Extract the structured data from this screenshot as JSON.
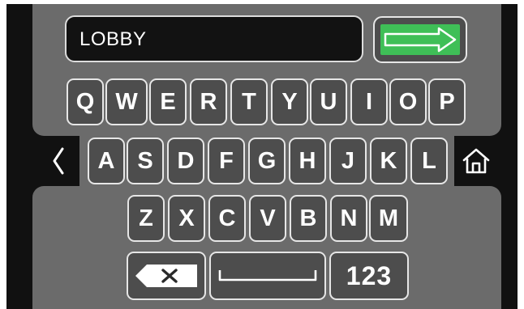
{
  "input": {
    "value": "LOBBY"
  },
  "enter_button": {
    "icon": "arrow-right-icon",
    "color": "#3fbf57"
  },
  "back_button": {
    "icon": "chevron-left-icon"
  },
  "home_button": {
    "icon": "home-icon"
  },
  "keyboard": {
    "row1": [
      "Q",
      "W",
      "E",
      "R",
      "T",
      "Y",
      "U",
      "I",
      "O",
      "P"
    ],
    "row2": [
      "A",
      "S",
      "D",
      "F",
      "G",
      "H",
      "J",
      "K",
      "L"
    ],
    "row3": [
      "Z",
      "X",
      "C",
      "V",
      "B",
      "N",
      "M"
    ],
    "backspace": {
      "icon": "backspace-icon"
    },
    "space": {
      "icon": "space-bar-icon"
    },
    "numbers_label": "123"
  },
  "colors": {
    "panel": "#6b6b6b",
    "key_face": "#4d4d4d",
    "frame": "#111111",
    "accent": "#3fbf57"
  }
}
